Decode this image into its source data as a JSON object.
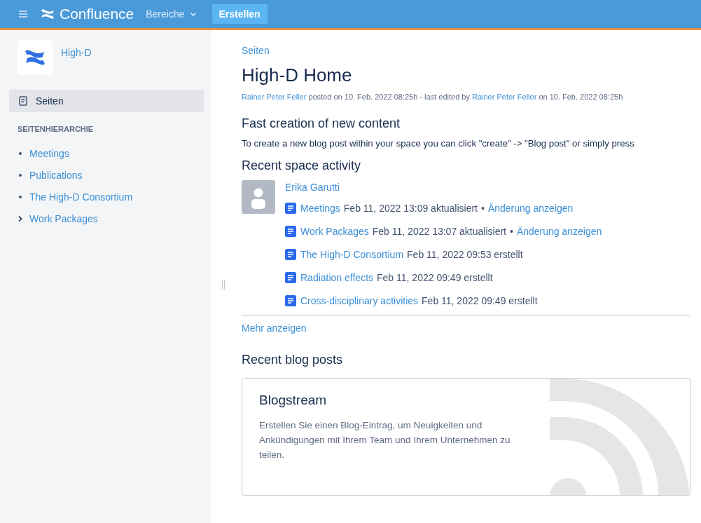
{
  "topbar": {
    "product": "Confluence",
    "menu": "Bereiche",
    "create": "Erstellen"
  },
  "sidebar": {
    "space": "High-D",
    "nav": {
      "label": "Seiten",
      "selected": true
    },
    "section": "SEITENHIERARCHIE",
    "tree": [
      {
        "label": "Meetings",
        "kind": "leaf"
      },
      {
        "label": "Publications",
        "kind": "leaf"
      },
      {
        "label": "The High-D Consortium",
        "kind": "leaf"
      },
      {
        "label": "Work Packages",
        "kind": "collapsed"
      }
    ]
  },
  "page": {
    "breadcrumb": "Seiten",
    "title": "High-D Home",
    "byline": {
      "author": "Rainer Peter Feller",
      "posted": "posted on 10. Feb. 2022 08:25h - last edited by",
      "editor": "Rainer Peter Feller",
      "edited": "on 10. Feb. 2022 08:25h"
    },
    "sections": [
      {
        "heading": "Fast creation of new content",
        "text": "To create a new blog post within your space you can click \"create\" -> \"Blog post\" or simply press"
      }
    ],
    "activity": {
      "heading": "Recent space activity",
      "user": "Erika Garutti",
      "items": [
        {
          "title": "Meetings",
          "meta": "Feb 11, 2022 13:09 aktualisiert",
          "separator": "•",
          "link": "Änderung anzeigen"
        },
        {
          "title": "Work Packages",
          "meta": "Feb 11, 2022 13:07 aktualisiert",
          "separator": "•",
          "link": "Änderung anzeigen"
        },
        {
          "title": "The High-D Consortium",
          "meta": "Feb 11, 2022 09:53 erstellt"
        },
        {
          "title": "Radiation effects",
          "meta": "Feb 11, 2022 09:49 erstellt"
        },
        {
          "title": "Cross-disciplinary activities",
          "meta": "Feb 11, 2022 09:49 erstellt"
        }
      ],
      "more": "Mehr anzeigen"
    },
    "blog": {
      "heading": "Recent blog posts",
      "title": "Blogstream",
      "text": "Erstellen Sie einen Blog-Eintrag, um Neuigkeiten und Ankündigungen mit Ihrem Team und Ihrem Unternehmen zu teilen."
    }
  }
}
